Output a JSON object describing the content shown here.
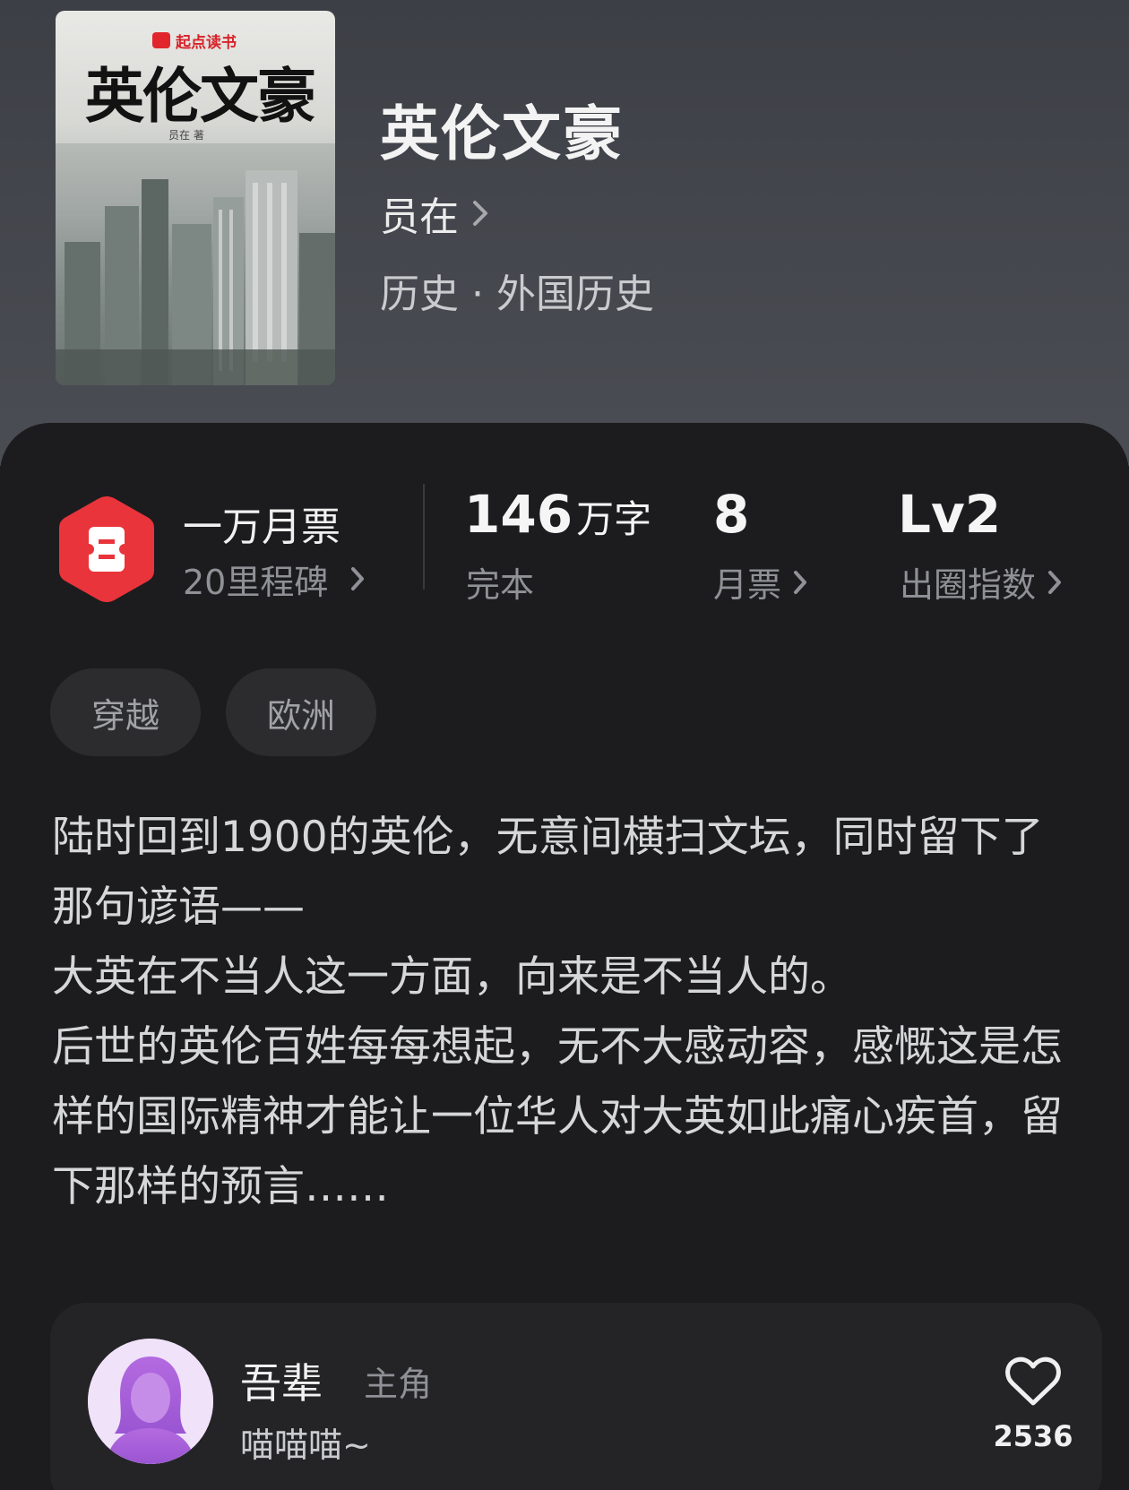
{
  "book": {
    "cover": {
      "brand": "起点读书",
      "title": "英伦文豪",
      "author_line": "员在 著"
    },
    "title": "英伦文豪",
    "author": "员在",
    "genre": "历史 · 外国历史"
  },
  "milestone": {
    "title": "一万月票",
    "subtitle": "20里程碑"
  },
  "stats": {
    "words_value": "146",
    "words_unit": "万字",
    "words_label": "完本",
    "tickets_value": "8",
    "tickets_label": "月票",
    "level_value": "Lv2",
    "level_label": "出圈指数"
  },
  "tags": [
    "穿越",
    "欧洲"
  ],
  "synopsis": [
    "陆时回到1900的英伦，无意间横扫文坛，同时留下了那句谚语——",
    "大英在不当人这一方面，向来是不当人的。",
    "后世的英伦百姓每每想起，无不大感动容，感慨这是怎样的国际精神才能让一位华人对大英如此痛心疾首，留下那样的预言……"
  ],
  "character": {
    "name": "吾辈",
    "role": "主角",
    "quote": "喵喵喵~",
    "likes": "2536"
  },
  "colors": {
    "accent_red": "#e8343a",
    "background": "#1c1c1e",
    "header_bg": "#43464c"
  },
  "icons": [
    "ticket-hex-icon",
    "chevron-right-icon",
    "heart-outline-icon",
    "avatar-silhouette"
  ]
}
